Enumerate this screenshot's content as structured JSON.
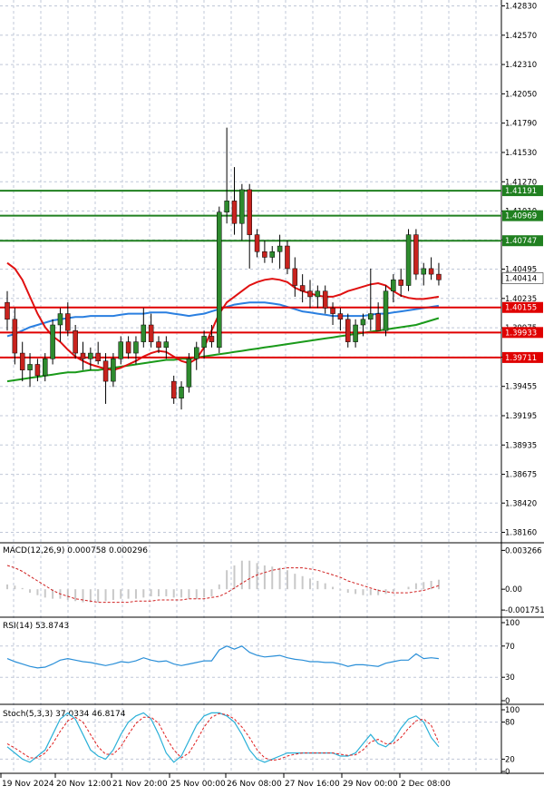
{
  "colors": {
    "background": "#ffffff",
    "grid": "#c0c8d8",
    "axis": "#000000",
    "bull": "#2e8b2e",
    "bear": "#c8231e",
    "wick": "#000000",
    "ma_red": "#e01010",
    "ma_blue": "#2a7fe0",
    "ma_green": "#1a9a1a",
    "level_green": "#208020",
    "level_red": "#e00000",
    "macd_hist": "#c8c8c8",
    "macd_signal": "#d02020",
    "rsi_line": "#2a8fd8",
    "stoch_main": "#2ab0d8",
    "stoch_signal": "#e02020",
    "label_text": "#000000",
    "label_text_light": "#ffffff"
  },
  "chart_data": [
    {
      "type": "candlestick",
      "title": "",
      "y_range": [
        1.381,
        1.4285
      ],
      "y_ticks": [
        "1.42830",
        "1.42570",
        "1.42310",
        "1.42050",
        "1.41790",
        "1.41530",
        "1.41270",
        "1.41010",
        "1.40755",
        "1.40495",
        "1.40235",
        "1.39975",
        "1.39715",
        "1.39455",
        "1.39195",
        "1.38935",
        "1.38675",
        "1.38420",
        "1.38160"
      ],
      "x_labels": [
        "19 Nov 2024",
        "20 Nov 12:00",
        "21 Nov 20:00",
        "25 Nov 00:00",
        "26 Nov 08:00",
        "27 Nov 16:00",
        "29 Nov 00:00",
        "2 Dec 08:00"
      ],
      "current_price": "1.40414",
      "levels": [
        {
          "value": 1.41191,
          "label": "1.41191",
          "kind": "resistance"
        },
        {
          "value": 1.40969,
          "label": "1.40969",
          "kind": "resistance"
        },
        {
          "value": 1.40747,
          "label": "1.40747",
          "kind": "resistance"
        },
        {
          "value": 1.40155,
          "label": "1.40155",
          "kind": "support"
        },
        {
          "value": 1.39933,
          "label": "1.39933",
          "kind": "support"
        },
        {
          "value": 1.39711,
          "label": "1.39711",
          "kind": "support"
        }
      ],
      "ohlc": [
        [
          1.402,
          1.403,
          1.3995,
          1.4005
        ],
        [
          1.4005,
          1.4015,
          1.3965,
          1.3975
        ],
        [
          1.3975,
          1.3985,
          1.395,
          1.396
        ],
        [
          1.396,
          1.3975,
          1.3945,
          1.3965
        ],
        [
          1.3965,
          1.397,
          1.395,
          1.3955
        ],
        [
          1.3955,
          1.3975,
          1.395,
          1.397
        ],
        [
          1.397,
          1.4005,
          1.3965,
          1.4
        ],
        [
          1.4,
          1.4015,
          1.3985,
          1.401
        ],
        [
          1.401,
          1.402,
          1.399,
          1.3995
        ],
        [
          1.3995,
          1.4,
          1.397,
          1.3975
        ],
        [
          1.3975,
          1.3985,
          1.396,
          1.397
        ],
        [
          1.397,
          1.398,
          1.396,
          1.3975
        ],
        [
          1.3975,
          1.3985,
          1.3965,
          1.3968
        ],
        [
          1.3968,
          1.3975,
          1.393,
          1.395
        ],
        [
          1.395,
          1.3975,
          1.3945,
          1.397
        ],
        [
          1.397,
          1.399,
          1.3965,
          1.3985
        ],
        [
          1.3985,
          1.399,
          1.397,
          1.3975
        ],
        [
          1.3975,
          1.399,
          1.3965,
          1.3985
        ],
        [
          1.3985,
          1.4015,
          1.398,
          1.4
        ],
        [
          1.4,
          1.401,
          1.398,
          1.3985
        ],
        [
          1.3985,
          1.399,
          1.3975,
          1.398
        ],
        [
          1.398,
          1.399,
          1.397,
          1.3985
        ],
        [
          1.395,
          1.3955,
          1.393,
          1.3935
        ],
        [
          1.3935,
          1.395,
          1.3925,
          1.3945
        ],
        [
          1.3945,
          1.3975,
          1.394,
          1.397
        ],
        [
          1.397,
          1.3985,
          1.396,
          1.398
        ],
        [
          1.398,
          1.3995,
          1.397,
          1.399
        ],
        [
          1.399,
          1.4,
          1.398,
          1.3985
        ],
        [
          1.398,
          1.4105,
          1.3975,
          1.41
        ],
        [
          1.41,
          1.4175,
          1.409,
          1.411
        ],
        [
          1.411,
          1.414,
          1.408,
          1.409
        ],
        [
          1.409,
          1.4125,
          1.4075,
          1.412
        ],
        [
          1.412,
          1.4125,
          1.405,
          1.408
        ],
        [
          1.408,
          1.4085,
          1.406,
          1.4065
        ],
        [
          1.4065,
          1.4075,
          1.4055,
          1.406
        ],
        [
          1.406,
          1.407,
          1.4055,
          1.4065
        ],
        [
          1.4065,
          1.408,
          1.405,
          1.407
        ],
        [
          1.407,
          1.4075,
          1.4045,
          1.405
        ],
        [
          1.405,
          1.406,
          1.4025,
          1.4035
        ],
        [
          1.4035,
          1.4045,
          1.402,
          1.403
        ],
        [
          1.403,
          1.404,
          1.4015,
          1.4025
        ],
        [
          1.4025,
          1.4035,
          1.4015,
          1.403
        ],
        [
          1.403,
          1.4035,
          1.401,
          1.4015
        ],
        [
          1.4015,
          1.402,
          1.4,
          1.401
        ],
        [
          1.401,
          1.4015,
          1.3995,
          1.4005
        ],
        [
          1.4005,
          1.401,
          1.398,
          1.3985
        ],
        [
          1.3985,
          1.4005,
          1.398,
          1.4
        ],
        [
          1.4,
          1.401,
          1.399,
          1.4005
        ],
        [
          1.4005,
          1.405,
          1.3995,
          1.401
        ],
        [
          1.401,
          1.402,
          1.3995,
          1.3995
        ],
        [
          1.3995,
          1.4035,
          1.399,
          1.403
        ],
        [
          1.403,
          1.4045,
          1.402,
          1.404
        ],
        [
          1.404,
          1.405,
          1.4025,
          1.4035
        ],
        [
          1.4035,
          1.4085,
          1.403,
          1.408
        ],
        [
          1.408,
          1.4085,
          1.404,
          1.4045
        ],
        [
          1.4045,
          1.4055,
          1.4035,
          1.405
        ],
        [
          1.405,
          1.406,
          1.404,
          1.4045
        ],
        [
          1.4045,
          1.4055,
          1.4035,
          1.404
        ]
      ],
      "ma_red": [
        1.4055,
        1.405,
        1.404,
        1.4025,
        1.401,
        1.3998,
        1.399,
        1.3985,
        1.3978,
        1.3972,
        1.3968,
        1.3965,
        1.3963,
        1.3961,
        1.396,
        1.3962,
        1.3965,
        1.3968,
        1.3972,
        1.3975,
        1.3977,
        1.3976,
        1.3972,
        1.3968,
        1.3966,
        1.397,
        1.398,
        1.3995,
        1.401,
        1.402,
        1.4025,
        1.403,
        1.4035,
        1.4038,
        1.404,
        1.4041,
        1.404,
        1.4038,
        1.4033,
        1.403,
        1.4028,
        1.4026,
        1.4025,
        1.4025,
        1.4027,
        1.403,
        1.4032,
        1.4034,
        1.4036,
        1.4037,
        1.4035,
        1.403,
        1.4026,
        1.4024,
        1.4023,
        1.4023,
        1.4024,
        1.4025
      ],
      "ma_blue": [
        1.399,
        1.3992,
        1.3995,
        1.3998,
        1.4,
        1.4002,
        1.4004,
        1.4005,
        1.4006,
        1.4007,
        1.4007,
        1.4008,
        1.4008,
        1.4008,
        1.4008,
        1.4009,
        1.401,
        1.401,
        1.401,
        1.4011,
        1.4011,
        1.4011,
        1.401,
        1.4009,
        1.4008,
        1.4009,
        1.401,
        1.4012,
        1.4014,
        1.4016,
        1.4018,
        1.4019,
        1.402,
        1.402,
        1.402,
        1.4019,
        1.4018,
        1.4016,
        1.4014,
        1.4012,
        1.4011,
        1.401,
        1.4009,
        1.4008,
        1.4008,
        1.4008,
        1.4008,
        1.4008,
        1.4009,
        1.401,
        1.401,
        1.4011,
        1.4012,
        1.4013,
        1.4014,
        1.4015,
        1.4016,
        1.4017
      ],
      "ma_green": [
        1.395,
        1.3951,
        1.3952,
        1.3953,
        1.3954,
        1.3955,
        1.3956,
        1.3957,
        1.3958,
        1.3958,
        1.3959,
        1.396,
        1.396,
        1.3961,
        1.3962,
        1.3963,
        1.3964,
        1.3965,
        1.3966,
        1.3967,
        1.3968,
        1.3969,
        1.3969,
        1.397,
        1.397,
        1.3971,
        1.3972,
        1.3973,
        1.3974,
        1.3975,
        1.3976,
        1.3977,
        1.3978,
        1.3979,
        1.398,
        1.3981,
        1.3982,
        1.3983,
        1.3984,
        1.3985,
        1.3986,
        1.3987,
        1.3988,
        1.3989,
        1.399,
        1.3991,
        1.3992,
        1.3993,
        1.3994,
        1.3995,
        1.3996,
        1.3997,
        1.3998,
        1.3999,
        1.4,
        1.4002,
        1.4004,
        1.4006
      ]
    },
    {
      "type": "bar",
      "title": "MACD(12,26,9) 0.000758 0.000296",
      "y_range": [
        -0.0022,
        0.0036
      ],
      "y_ticks": [
        "0.003266",
        "0.00",
        "-0.001751"
      ],
      "histogram": [
        0.0004,
        0.0003,
        0.0001,
        -0.0003,
        -0.0005,
        -0.0007,
        -0.0008,
        -0.0008,
        -0.0009,
        -0.001,
        -0.0011,
        -0.0011,
        -0.0011,
        -0.001,
        -0.0009,
        -0.0008,
        -0.0008,
        -0.0008,
        -0.0007,
        -0.0006,
        -0.0006,
        -0.0006,
        -0.0007,
        -0.0007,
        -0.0008,
        -0.0008,
        -0.0007,
        -0.0006,
        0.0004,
        0.0016,
        0.002,
        0.0024,
        0.0024,
        0.0022,
        0.002,
        0.0019,
        0.0018,
        0.0016,
        0.0013,
        0.0011,
        0.0009,
        0.0007,
        0.0005,
        0.0002,
        -0.0001,
        -0.0003,
        -0.0004,
        -0.0005,
        -0.0005,
        -0.0005,
        -0.0004,
        -0.0002,
        0.0,
        0.0002,
        0.0005,
        0.0006,
        0.0007,
        0.0008
      ],
      "signal": [
        0.002,
        0.0018,
        0.0015,
        0.0011,
        0.0007,
        0.0003,
        -0.0001,
        -0.0004,
        -0.0006,
        -0.0008,
        -0.0009,
        -0.001,
        -0.0011,
        -0.0011,
        -0.0011,
        -0.0011,
        -0.0011,
        -0.001,
        -0.001,
        -0.001,
        -0.0009,
        -0.0009,
        -0.0009,
        -0.0009,
        -0.0008,
        -0.0008,
        -0.0008,
        -0.0007,
        -0.0006,
        -0.0003,
        0.0001,
        0.0005,
        0.0009,
        0.0012,
        0.0014,
        0.0016,
        0.0017,
        0.0018,
        0.0018,
        0.0018,
        0.0017,
        0.0016,
        0.0014,
        0.0012,
        0.001,
        0.0007,
        0.0005,
        0.0003,
        0.0001,
        -0.0001,
        -0.0002,
        -0.0003,
        -0.0003,
        -0.0003,
        -0.0002,
        -0.0001,
        0.0001,
        0.0003
      ]
    },
    {
      "type": "line",
      "title": "RSI(14) 53.8743",
      "y_range": [
        0,
        100
      ],
      "y_ticks": [
        "100",
        "70",
        "30",
        "0"
      ],
      "values": [
        54,
        50,
        47,
        44,
        42,
        43,
        47,
        52,
        54,
        52,
        50,
        49,
        47,
        45,
        47,
        50,
        49,
        51,
        55,
        52,
        50,
        51,
        47,
        45,
        47,
        49,
        51,
        51,
        65,
        70,
        66,
        70,
        62,
        58,
        56,
        57,
        58,
        55,
        53,
        52,
        50,
        50,
        49,
        49,
        47,
        44,
        46,
        46,
        45,
        44,
        48,
        50,
        52,
        52,
        60,
        54,
        55,
        54
      ]
    },
    {
      "type": "line",
      "title": "Stoch(5,3,3) 37.0334 46.8174",
      "y_range": [
        0,
        100
      ],
      "y_ticks": [
        "100",
        "80",
        "20",
        "0"
      ],
      "main": [
        40,
        30,
        20,
        15,
        25,
        35,
        60,
        85,
        95,
        85,
        60,
        35,
        25,
        20,
        35,
        60,
        80,
        90,
        95,
        85,
        60,
        30,
        15,
        25,
        50,
        75,
        90,
        95,
        95,
        90,
        80,
        60,
        35,
        20,
        15,
        20,
        25,
        30,
        30,
        30,
        30,
        30,
        30,
        30,
        25,
        25,
        30,
        45,
        60,
        45,
        40,
        50,
        70,
        85,
        90,
        80,
        55,
        40
      ],
      "signal": [
        45,
        38,
        30,
        22,
        22,
        30,
        45,
        65,
        82,
        88,
        80,
        60,
        40,
        28,
        28,
        40,
        60,
        78,
        88,
        88,
        78,
        55,
        35,
        22,
        30,
        50,
        72,
        88,
        94,
        92,
        85,
        72,
        55,
        35,
        22,
        18,
        20,
        25,
        28,
        30,
        30,
        30,
        30,
        30,
        28,
        26,
        27,
        35,
        48,
        52,
        45,
        45,
        55,
        70,
        82,
        85,
        75,
        47
      ]
    }
  ]
}
